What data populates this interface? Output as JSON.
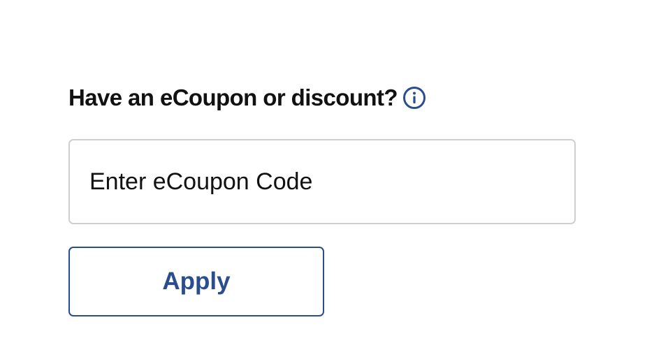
{
  "coupon": {
    "heading": "Have an eCoupon or discount?",
    "info_icon": "info-circle-icon",
    "input_placeholder": "Enter eCoupon Code",
    "input_value": "",
    "apply_label": "Apply"
  },
  "colors": {
    "accent": "#2a4d8f",
    "text": "#111111",
    "input_border": "#cfcfcf",
    "background": "#ffffff"
  }
}
